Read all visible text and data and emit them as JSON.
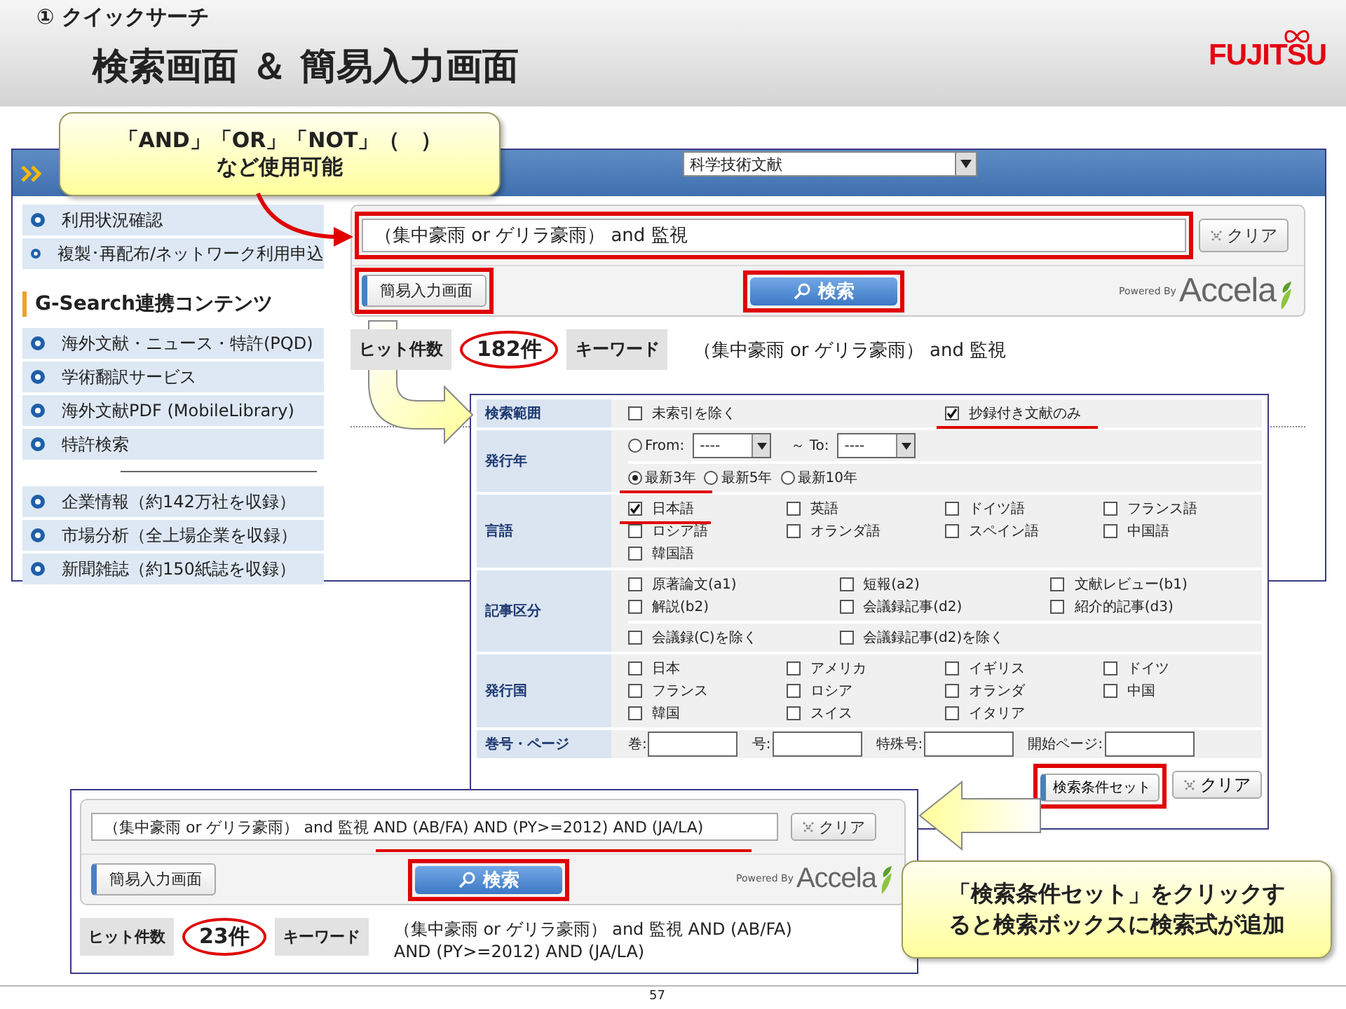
{
  "slide": {
    "section": "① クイックサーチ",
    "title": "検索画面 ＆ 簡易入力画面",
    "logo": "FUJITSU",
    "page_number": "57"
  },
  "callouts": [
    {
      "lines": [
        "「AND」「OR」「NOT」（　）",
        "など使用可能"
      ]
    },
    {
      "lines": [
        "「検索条件セット」をクリックす",
        "ると検索ボックスに検索式が追加"
      ]
    }
  ],
  "main_screen": {
    "database": "科学技術文献",
    "sidebar": {
      "groups": [
        {
          "items": [
            "利用状況確認",
            "複製･再配布/ネットワーク利用申込"
          ]
        },
        {
          "heading": "G-Search連携コンテンツ",
          "items": [
            "海外文献・ニュース・特許(PQD)",
            "学術翻訳サービス",
            "海外文献PDF (MobileLibrary)",
            "特許検索"
          ]
        },
        {
          "items": [
            "企業情報（約142万社を収録）",
            "市場分析（全上場企業を収録）",
            "新聞雑誌（約150紙誌を収録）"
          ]
        }
      ]
    },
    "search": {
      "query": "（集中豪雨 or ゲリラ豪雨） and 監視",
      "highlighted": true,
      "clear_label": "クリア",
      "simple_input": {
        "label": "簡易入力画面",
        "highlighted": true
      },
      "search_button": {
        "label": "検索",
        "highlighted": true
      },
      "powered_by": "Powered By",
      "brand": "Accela"
    },
    "results": {
      "hit_label": "ヒット件数",
      "hit_count": "182件",
      "circled": true,
      "keyword_label": "キーワード",
      "keyword": "（集中豪雨 or ゲリラ豪雨） and 監視"
    }
  },
  "form": {
    "rows": [
      {
        "label": "検索範囲",
        "kind": "pair",
        "groups": [
          [
            {
              "kind": "checkbox",
              "label": "未索引を除く",
              "checked": false,
              "marked": false
            },
            {
              "kind": "checkbox",
              "label": "抄録付き文献のみ",
              "checked": true,
              "marked": true
            }
          ]
        ]
      },
      {
        "label": "発行年",
        "kind": "year",
        "groups": [
          [
            {
              "kind": "radio",
              "label": "From:",
              "selected": false,
              "marked": false
            },
            {
              "kind": "select",
              "value": "----"
            },
            {
              "kind": "text",
              "label": "～ To:"
            },
            {
              "kind": "select",
              "value": "----"
            }
          ],
          [
            {
              "kind": "radio",
              "label": "最新3年",
              "selected": true,
              "marked": true
            },
            {
              "kind": "radio",
              "label": "最新5年",
              "selected": false,
              "marked": false
            },
            {
              "kind": "radio",
              "label": "最新10年",
              "selected": false,
              "marked": false
            }
          ]
        ]
      },
      {
        "label": "言語",
        "kind": "quad",
        "groups": [
          [
            {
              "kind": "checkbox",
              "label": "日本語",
              "checked": true,
              "marked": true
            },
            {
              "kind": "checkbox",
              "label": "英語",
              "checked": false,
              "marked": false
            },
            {
              "kind": "checkbox",
              "label": "ドイツ語",
              "checked": false,
              "marked": false
            },
            {
              "kind": "checkbox",
              "label": "フランス語",
              "checked": false,
              "marked": false
            },
            {
              "kind": "checkbox",
              "label": "ロシア語",
              "checked": false,
              "marked": false
            },
            {
              "kind": "checkbox",
              "label": "オランダ語",
              "checked": false,
              "marked": false
            },
            {
              "kind": "checkbox",
              "label": "スペイン語",
              "checked": false,
              "marked": false
            },
            {
              "kind": "checkbox",
              "label": "中国語",
              "checked": false,
              "marked": false
            },
            {
              "kind": "checkbox",
              "label": "韓国語",
              "checked": false,
              "marked": false
            }
          ]
        ]
      },
      {
        "label": "記事区分",
        "kind": "triple",
        "groups": [
          [
            {
              "kind": "checkbox",
              "label": "原著論文(a1)",
              "checked": false,
              "marked": false
            },
            {
              "kind": "checkbox",
              "label": "短報(a2)",
              "checked": false,
              "marked": false
            },
            {
              "kind": "checkbox",
              "label": "文献レビュー(b1)",
              "checked": false,
              "marked": false
            },
            {
              "kind": "checkbox",
              "label": "解説(b2)",
              "checked": false,
              "marked": false
            },
            {
              "kind": "checkbox",
              "label": "会議録記事(d2)",
              "checked": false,
              "marked": false
            },
            {
              "kind": "checkbox",
              "label": "紹介的記事(d3)",
              "checked": false,
              "marked": false
            }
          ],
          [
            {
              "kind": "checkbox",
              "label": "会議録(C)を除く",
              "checked": false,
              "marked": false
            },
            {
              "kind": "checkbox",
              "label": "会議録記事(d2)を除く",
              "checked": false,
              "marked": false
            }
          ]
        ]
      },
      {
        "label": "発行国",
        "kind": "quad",
        "groups": [
          [
            {
              "kind": "checkbox",
              "label": "日本",
              "checked": false,
              "marked": false
            },
            {
              "kind": "checkbox",
              "label": "アメリカ",
              "checked": false,
              "marked": false
            },
            {
              "kind": "checkbox",
              "label": "イギリス",
              "checked": false,
              "marked": false
            },
            {
              "kind": "checkbox",
              "label": "ドイツ",
              "checked": false,
              "marked": false
            },
            {
              "kind": "checkbox",
              "label": "フランス",
              "checked": false,
              "marked": false
            },
            {
              "kind": "checkbox",
              "label": "ロシア",
              "checked": false,
              "marked": false
            },
            {
              "kind": "checkbox",
              "label": "オランダ",
              "checked": false,
              "marked": false
            },
            {
              "kind": "checkbox",
              "label": "中国",
              "checked": false,
              "marked": false
            },
            {
              "kind": "checkbox",
              "label": "韓国",
              "checked": false,
              "marked": false
            },
            {
              "kind": "checkbox",
              "label": "スイス",
              "checked": false,
              "marked": false
            },
            {
              "kind": "checkbox",
              "label": "イタリア",
              "checked": false,
              "marked": false
            }
          ]
        ]
      },
      {
        "label": "巻号・ページ",
        "kind": "fields",
        "groups": [
          [
            {
              "kind": "field",
              "label": "巻:"
            },
            {
              "kind": "field",
              "label": "号:"
            },
            {
              "kind": "field",
              "label": "特殊号:"
            },
            {
              "kind": "field",
              "label": "開始ページ:"
            }
          ]
        ]
      }
    ],
    "set_button": {
      "label": "検索条件セット",
      "highlighted": true
    },
    "clear_label": "クリア"
  },
  "result_screen": {
    "search": {
      "query": "（集中豪雨 or ゲリラ豪雨） and 監視 AND (AB/FA) AND (PY>=2012) AND (JA/LA)",
      "highlighted": false,
      "underlined": true,
      "clear_label": "クリア",
      "simple_input": {
        "label": "簡易入力画面",
        "highlighted": false
      },
      "search_button": {
        "label": "検索",
        "highlighted": true
      },
      "powered_by": "Powered By",
      "brand": "Accela"
    },
    "results": {
      "hit_label": "ヒット件数",
      "hit_count": "23件",
      "circled": true,
      "keyword_label": "キーワード",
      "keyword": "（集中豪雨 or ゲリラ豪雨） and 監視 AND (AB/FA) AND (PY>=2012) AND (JA/LA)"
    }
  }
}
